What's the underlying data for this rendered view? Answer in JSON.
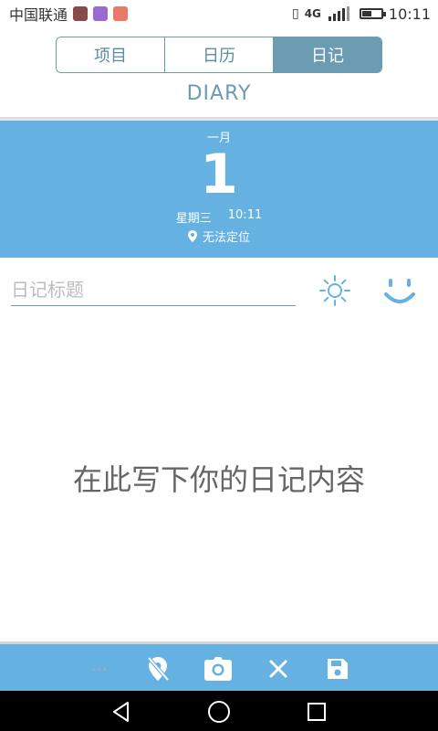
{
  "status_bar": {
    "carrier": "中国联通",
    "network": "4G",
    "network2": "4G",
    "time": "10:11",
    "battery_level": 0.5
  },
  "tabs": [
    {
      "label": "项目",
      "active": false
    },
    {
      "label": "日历",
      "active": false
    },
    {
      "label": "日记",
      "active": true
    }
  ],
  "diary_title": "DIARY",
  "date_block": {
    "month": "一月",
    "day": "1",
    "weekday": "星期三",
    "time": "10:11",
    "location": "无法定位"
  },
  "entry": {
    "title_placeholder": "日记标题",
    "content_placeholder": "在此写下你的日记内容"
  },
  "toolbar": {
    "more_label": "···"
  },
  "icons": {
    "weather": "sun-icon",
    "mood": "smile-icon",
    "location_off": "location-off-icon",
    "camera": "camera-icon",
    "delete": "close-icon",
    "save": "save-icon",
    "nav_back": "back-triangle-icon",
    "nav_home": "home-circle-icon",
    "nav_recent": "recent-square-icon"
  },
  "colors": {
    "accent": "#6b9cb1",
    "date_block_bg": "#64b1e2",
    "toolbar_bg": "#64b1e2"
  }
}
